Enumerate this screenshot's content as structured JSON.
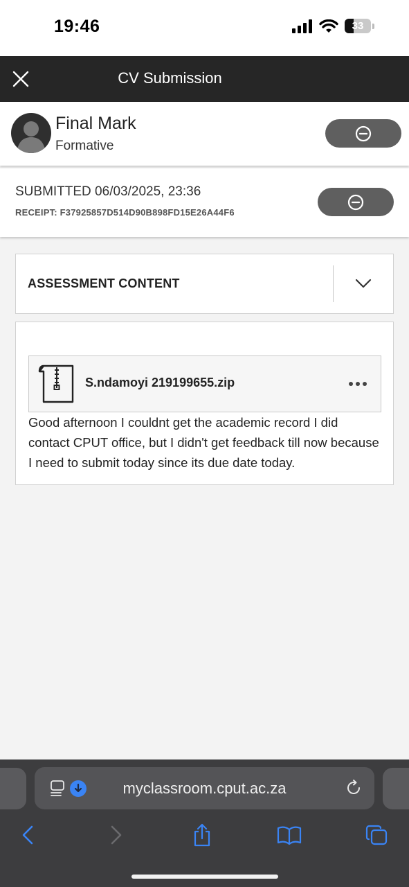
{
  "status_bar": {
    "time": "19:46",
    "battery": "33",
    "battery_level": 0.33
  },
  "header": {
    "title": "CV Submission",
    "close_icon": "close-icon"
  },
  "final_mark": {
    "title": "Final Mark",
    "subtitle": "Formative",
    "action_icon": "minus-circle-icon"
  },
  "submission": {
    "submitted": "SUBMITTED 06/03/2025, 23:36",
    "receipt": "RECEIPT: F37925857D514D90B898FD15E26A44F6",
    "action_icon": "minus-circle-icon"
  },
  "assessment": {
    "title": "ASSESSMENT CONTENT",
    "toggle_icon": "chevron-down-icon"
  },
  "attachment": {
    "file_name": "S.ndamoyi 219199655.zip",
    "file_icon": "zip-file-icon",
    "more_icon": "more-horizontal-icon"
  },
  "comment": "Good afternoon I couldnt get the academic record I did contact CPUT office, but I didn't get feedback till now because I need to submit today since its due date today.",
  "browser": {
    "url": "myclassroom.cput.ac.za",
    "icons": [
      "reader-icon",
      "download-icon",
      "reload-icon",
      "back-icon",
      "forward-icon",
      "share-icon",
      "bookmarks-icon",
      "tabs-icon"
    ]
  },
  "colors": {
    "header_bg": "#262626",
    "pill_bg": "#5f5f5f",
    "safari_bg": "#3d3d3f",
    "accent_blue": "#3a84f5"
  }
}
